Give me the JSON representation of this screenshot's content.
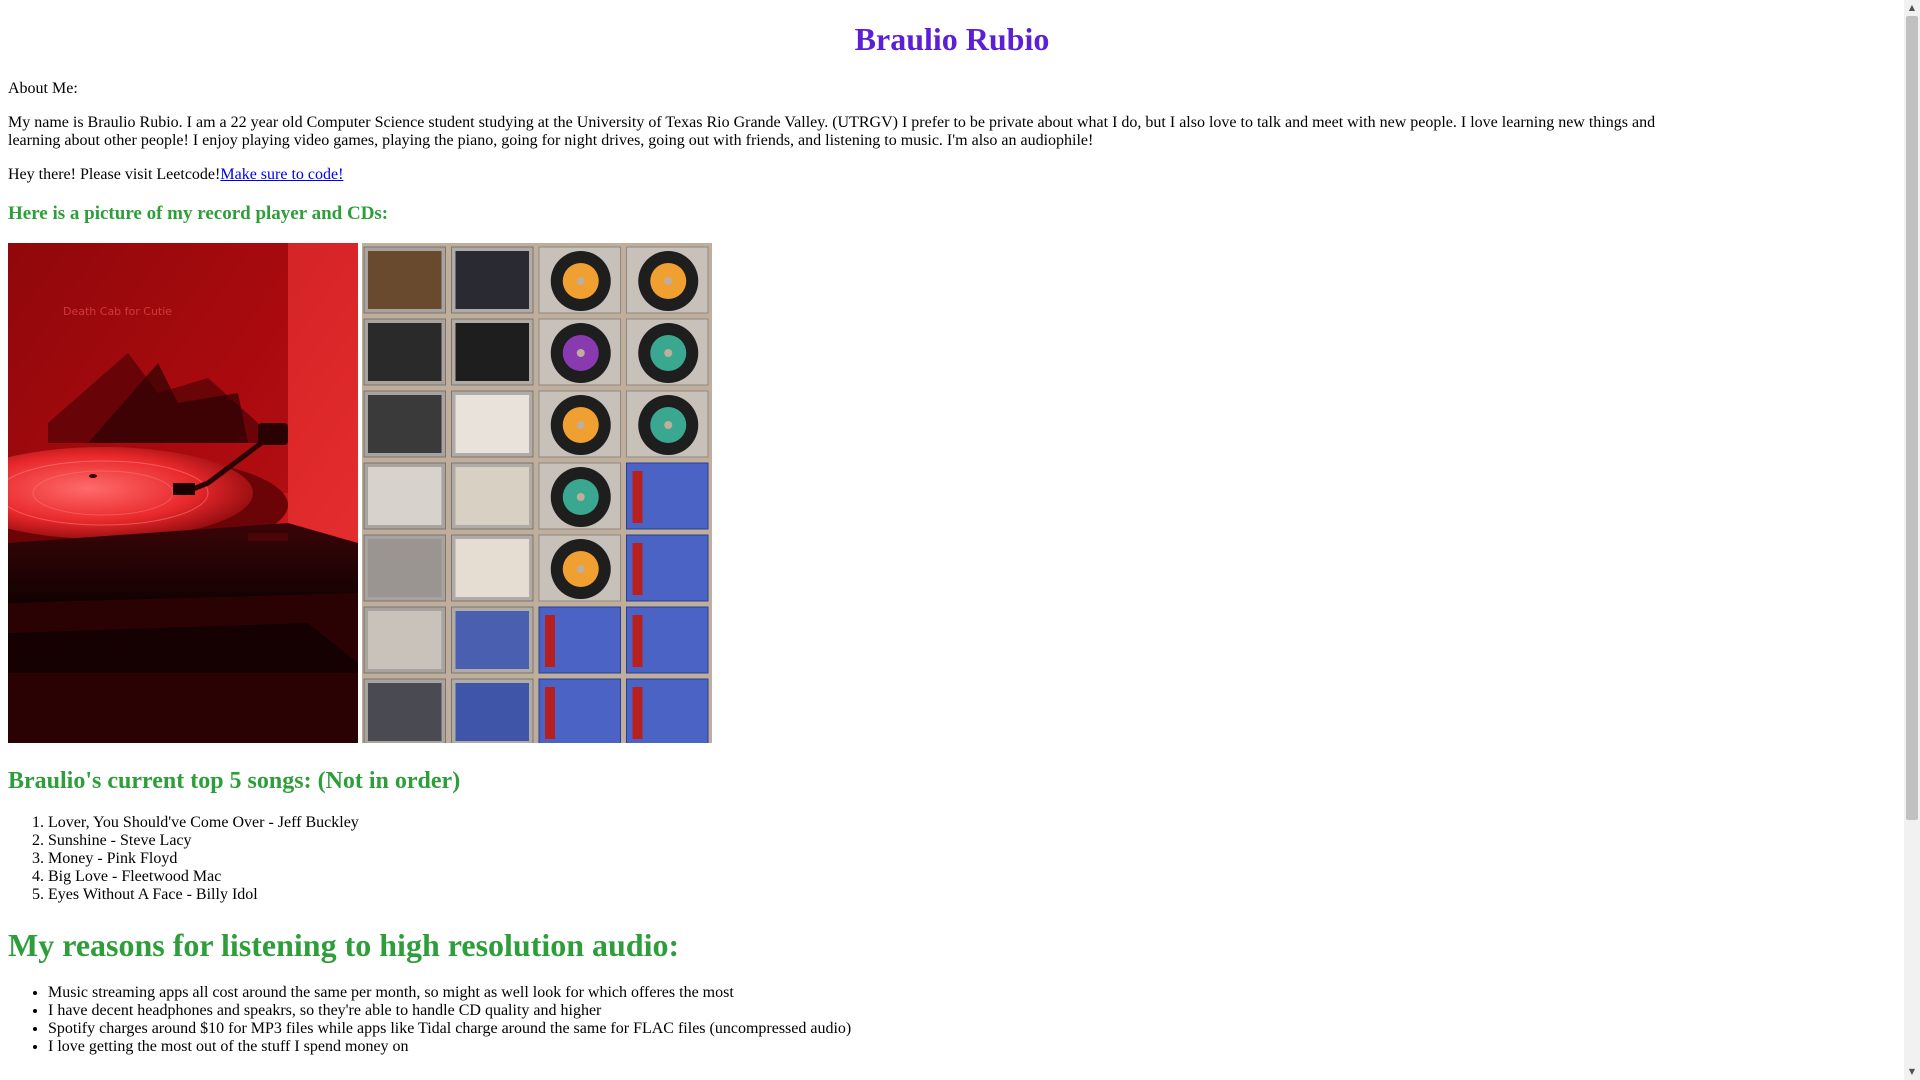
{
  "header": {
    "title": "Braulio Rubio"
  },
  "about": {
    "label": "About Me:",
    "bio": "My name is Braulio Rubio. I am a 22 year old Computer Science student studying at the University of Texas Rio Grande Valley. (UTRGV) I prefer to be private about what I do, but I also love to talk and meet with new people. I love learning new things and learning about other people! I enjoy playing video games, playing the piano, going for night drives, going out with friends, and listening to music. I'm also an audiophile!"
  },
  "visit": {
    "text": "Hey there! Please visit Leetcode!",
    "link_label": "Make sure to code!"
  },
  "pictures": {
    "heading": "Here is a picture of my record player and CDs:"
  },
  "songs": {
    "heading": "Braulio's current top 5 songs: (Not in order)",
    "items": [
      "Lover, You Should've Come Over - Jeff Buckley",
      "Sunshine - Steve Lacy",
      "Money - Pink Floyd",
      "Big Love - Fleetwood Mac",
      "Eyes Without A Face - Billy Idol"
    ]
  },
  "reasons": {
    "heading": "My reasons for listening to high resolution audio:",
    "items": [
      "Music streaming apps all cost around the same per month, so might as well look for which offeres the most",
      "I have decent headphones and speakrs, so they're able to handle CD quality and higher",
      "Spotify charges around $10 for MP3 files while apps like Tidal charge around the same for FLAC files (uncompressed audio)",
      "I love getting the most out of the stuff I spend money on"
    ]
  },
  "colors": {
    "title": "#5a1fd6",
    "headings": "#2e9e3a",
    "link": "#0000ee"
  },
  "images": {
    "left": "record-player-photo",
    "right": "cd-collection-photo"
  }
}
